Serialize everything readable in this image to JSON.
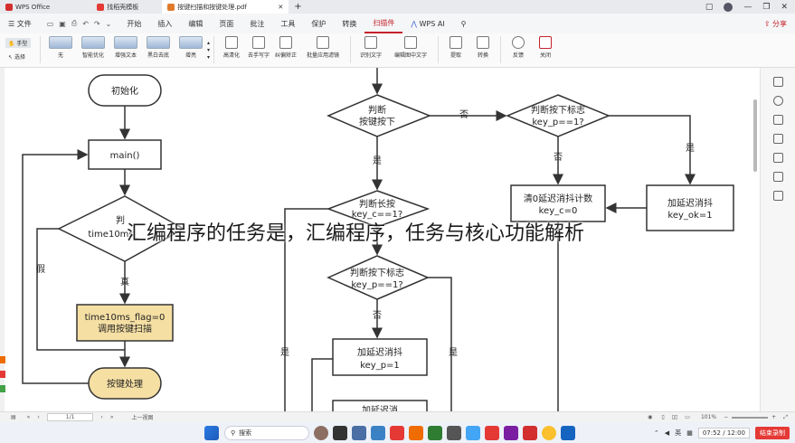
{
  "titlebar": {
    "app": "WPS Office",
    "tabs": [
      "找稻壳模板",
      "按键扫描和按键处理.pdf"
    ],
    "colors": {
      "wps": "#d32f2f",
      "doc": "#e07a2c"
    }
  },
  "menubar": {
    "file": "文件",
    "items": [
      "开始",
      "插入",
      "编辑",
      "页面",
      "批注",
      "工具",
      "保护",
      "转换",
      "扫描件"
    ],
    "ai": "WPS AI",
    "share": "分享"
  },
  "ribbon": {
    "hand": "手型",
    "select": "选择",
    "filters": [
      "无",
      "智能优化",
      "增强文本",
      "黑白去底",
      "增亮"
    ],
    "tools": [
      "高清化",
      "去手写字",
      "纠偏矫正",
      "批量应用滤镜"
    ],
    "ocr": [
      "识别文字",
      "编辑图中文字"
    ],
    "extract": "提取",
    "convert": "转换",
    "feedback": "反馈",
    "close": "关闭"
  },
  "flow_left": {
    "init": "初始化",
    "main": "main()",
    "decision_a": "判",
    "decision_b": "time10ms_",
    "false_label": "假",
    "true_label": "真",
    "process_a": "time10ms_flag=0",
    "process_b": "调用按键扫描",
    "handle": "按键处理"
  },
  "flow_right": {
    "judge_a": "判断",
    "judge_b": "按键按下",
    "no": "否",
    "yes": "是",
    "flag_a": "判断按下标志",
    "flag_b": "key_p==1?",
    "long_a": "判断长按",
    "long_b": "key_c==1?",
    "flag2_a": "判断按下标志",
    "flag2_b": "key_p==1?",
    "delay_a": "加延迟消抖",
    "delay_b": "key_p=1",
    "clear_a": "清0延迟消抖计数",
    "clear_b": "key_c=0",
    "delay2_a": "加延迟消抖",
    "delay2_b": "key_ok=1",
    "partial": "加延迟消"
  },
  "overlay_caption": "汇编程序的任务是，汇编程序，任务与核心功能解析",
  "statusbar": {
    "page": "1/1",
    "view": "上一视图",
    "zoom": "101%"
  },
  "taskbar": {
    "search": "搜索",
    "lang": "英",
    "time": "07:52",
    "total": "/ 12:00",
    "record": "结束录制"
  }
}
